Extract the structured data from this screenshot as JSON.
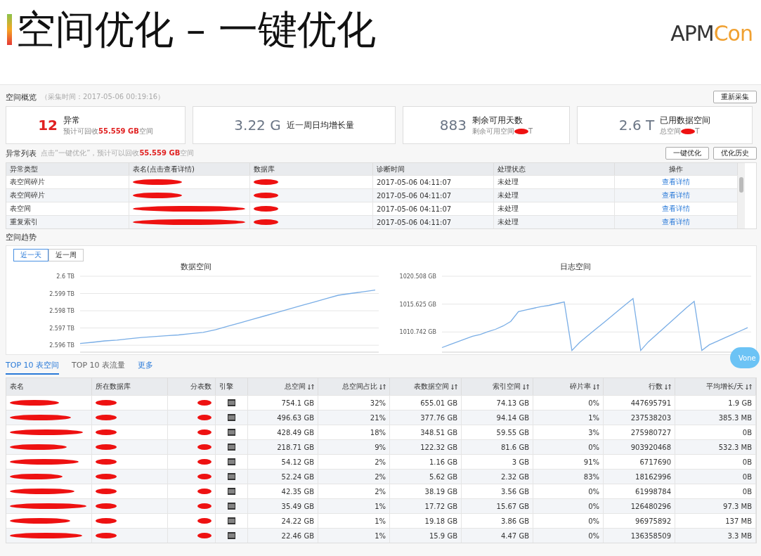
{
  "slide": {
    "title": "空间优化 – 一键优化",
    "logo_main": "APM",
    "logo_accent": "Con"
  },
  "overview": {
    "title": "空间概览",
    "subtitle": "（采集时间：2017-05-06 00:19:16）",
    "button": "重新采集",
    "cards": [
      {
        "kind": "alert",
        "value": "12",
        "label": "异常",
        "note_prefix": "预计可回收",
        "note_value": "55.559 GB",
        "note_suffix": "空间"
      },
      {
        "kind": "plain",
        "value": "3.22 G",
        "label": "近一周日均增长量"
      },
      {
        "kind": "redacted",
        "value": "883",
        "label": "剩余可用天数",
        "note_prefix": "剩余可用空间",
        "note_suffix": "T"
      },
      {
        "kind": "redacted",
        "value": "2.6 T",
        "label": "已用数据空间",
        "note_prefix": "总空间",
        "note_suffix": "T"
      }
    ]
  },
  "anomalies": {
    "title": "异常列表",
    "hint_prefix": "点击“一键优化”，预计可以回收",
    "hint_value": "55.559 GB",
    "hint_suffix": "空间",
    "buttons": [
      "一键优化",
      "优化历史"
    ],
    "columns": [
      "异常类型",
      "表名(点击查看详情)",
      "数据库",
      "诊断时间",
      "处理状态",
      "操作"
    ],
    "rows": [
      {
        "type": "表空间碎片",
        "time": "2017-05-06 04:11:07",
        "status": "未处理",
        "action": "查看详情"
      },
      {
        "type": "表空间碎片",
        "time": "2017-05-06 04:11:07",
        "status": "未处理",
        "action": "查看详情"
      },
      {
        "type": "表空间",
        "time": "2017-05-06 04:11:07",
        "status": "未处理",
        "action": "查看详情"
      },
      {
        "type": "重复索引",
        "time": "2017-05-06 04:11:07",
        "status": "未处理",
        "action": "查看详情"
      }
    ]
  },
  "trend": {
    "title": "空间趋势",
    "tabs": [
      {
        "label": "近一天",
        "selected": true
      },
      {
        "label": "近一周",
        "selected": false
      }
    ],
    "charts": [
      {
        "chart_data": {
          "type": "line",
          "title": "数据空间",
          "grid": true,
          "ylim": [
            2.5956,
            2.6
          ],
          "yticks": [
            {
              "value": 2.596,
              "label": "2.596 TB"
            },
            {
              "value": 2.597,
              "label": "2.597 TB"
            },
            {
              "value": 2.598,
              "label": "2.598 TB"
            },
            {
              "value": 2.599,
              "label": "2.599 TB"
            },
            {
              "value": 2.6,
              "label": "2.6 TB"
            }
          ],
          "series": [
            {
              "color": "#7aaee6",
              "values": [
                2.5961,
                2.59617,
                2.59625,
                2.5963,
                2.59638,
                2.59645,
                2.5965,
                2.59655,
                2.5966,
                2.59667,
                2.59675,
                2.5969,
                2.5971,
                2.5973,
                2.5975,
                2.5977,
                2.5979,
                2.5981,
                2.5983,
                2.5985,
                2.5987,
                2.5989,
                2.599,
                2.5991,
                2.5992
              ]
            }
          ]
        }
      },
      {
        "chart_data": {
          "type": "line",
          "title": "日志空间",
          "grid": true,
          "ylim": [
            1007.2,
            1020.508
          ],
          "yticks": [
            {
              "value": 1010.742,
              "label": "1010.742 GB"
            },
            {
              "value": 1015.625,
              "label": "1015.625 GB"
            },
            {
              "value": 1020.508,
              "label": "1020.508 GB"
            }
          ],
          "series": [
            {
              "color": "#7aaee6",
              "values": [
                1008.0,
                1008.5,
                1009.0,
                1009.5,
                1010.0,
                1010.3,
                1010.8,
                1011.2,
                1011.8,
                1012.6,
                1014.3,
                1014.6,
                1014.9,
                1015.2,
                1015.4,
                1015.7,
                1016.0,
                1007.5,
                1008.9,
                1010.0,
                1011.1,
                1012.2,
                1013.3,
                1014.4,
                1015.5,
                1016.6,
                1007.5,
                1009.0,
                1010.2,
                1011.4,
                1012.6,
                1013.8,
                1015.0,
                1016.1,
                1007.5,
                1008.5,
                1009.1,
                1009.7,
                1010.3,
                1010.9,
                1011.5
              ]
            }
          ]
        }
      }
    ]
  },
  "top10": {
    "tabs": [
      {
        "label": "TOP 10 表空间",
        "selected": true
      },
      {
        "label": "TOP 10 表流量",
        "selected": false
      }
    ],
    "more": "更多",
    "columns": [
      {
        "label": "表名",
        "sortable": false
      },
      {
        "label": "所在数据库",
        "sortable": false
      },
      {
        "label": "分表数",
        "sortable": false
      },
      {
        "label": "引擎",
        "sortable": false
      },
      {
        "label": "总空间",
        "sortable": true
      },
      {
        "label": "总空间占比",
        "sortable": true
      },
      {
        "label": "表数据空间",
        "sortable": true
      },
      {
        "label": "索引空间",
        "sortable": true
      },
      {
        "label": "碎片率",
        "sortable": true
      },
      {
        "label": "行数",
        "sortable": true
      },
      {
        "label": "平均增长/天",
        "sortable": true
      }
    ],
    "rows": [
      [
        "",
        "",
        "",
        "",
        "754.1 GB",
        "32%",
        "655.01 GB",
        "74.13 GB",
        "0%",
        "447695791",
        "1.9 GB"
      ],
      [
        "",
        "",
        "",
        "",
        "496.63 GB",
        "21%",
        "377.76 GB",
        "94.14 GB",
        "1%",
        "237538203",
        "385.3 MB"
      ],
      [
        "",
        "",
        "",
        "",
        "428.49 GB",
        "18%",
        "348.51 GB",
        "59.55 GB",
        "3%",
        "275980727",
        "0B"
      ],
      [
        "",
        "",
        "",
        "",
        "218.71 GB",
        "9%",
        "122.32 GB",
        "81.6 GB",
        "0%",
        "903920468",
        "532.3 MB"
      ],
      [
        "",
        "",
        "",
        "",
        "54.12 GB",
        "2%",
        "1.16 GB",
        "3 GB",
        "91%",
        "6717690",
        "0B"
      ],
      [
        "",
        "",
        "",
        "",
        "52.24 GB",
        "2%",
        "5.62 GB",
        "2.32 GB",
        "83%",
        "18162996",
        "0B"
      ],
      [
        "",
        "",
        "",
        "",
        "42.35 GB",
        "2%",
        "38.19 GB",
        "3.56 GB",
        "0%",
        "61998784",
        "0B"
      ],
      [
        "",
        "",
        "",
        "",
        "35.49 GB",
        "1%",
        "17.72 GB",
        "15.67 GB",
        "0%",
        "126480296",
        "97.3 MB"
      ],
      [
        "",
        "",
        "",
        "",
        "24.22 GB",
        "1%",
        "19.18 GB",
        "3.86 GB",
        "0%",
        "96975892",
        "137 MB"
      ],
      [
        "",
        "",
        "",
        "",
        "22.46 GB",
        "1%",
        "15.9 GB",
        "4.47 GB",
        "0%",
        "136358509",
        "3.3 MB"
      ]
    ]
  },
  "floating_button": "Vone"
}
